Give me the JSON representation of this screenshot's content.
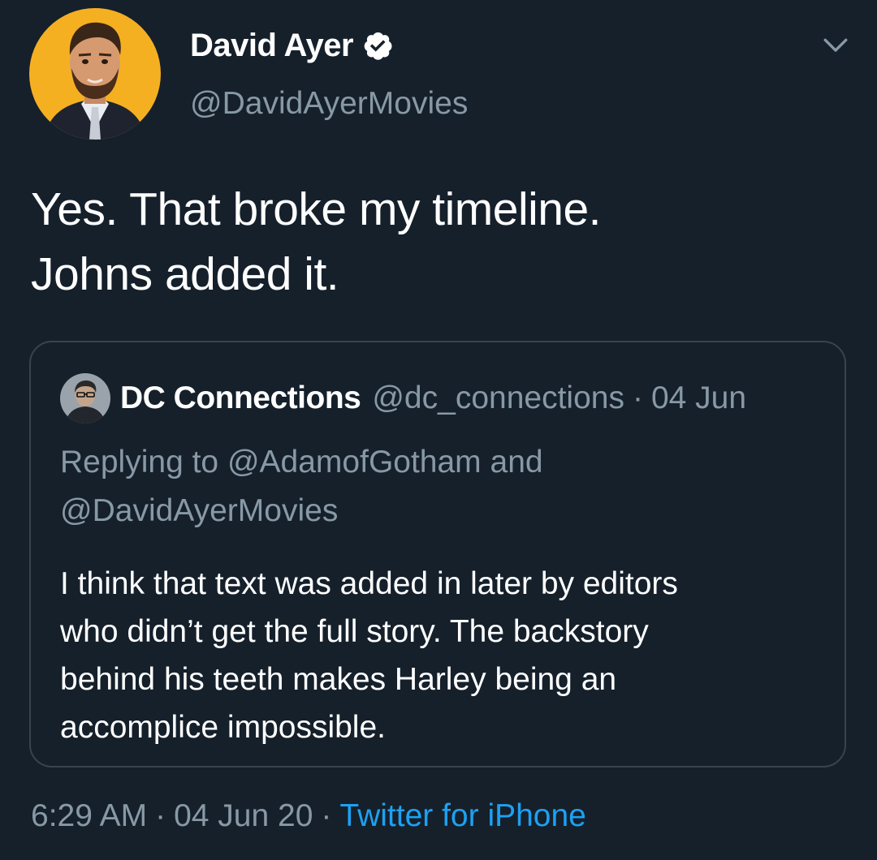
{
  "author": {
    "display_name": "David Ayer",
    "handle": "@DavidAyerMovies",
    "verified": true,
    "avatar_icon": "illustrated-portrait-avatar",
    "avatar_bg": "#f5b021"
  },
  "tweet": {
    "text_lines": [
      "Yes. That broke my timeline.",
      "Johns added it."
    ]
  },
  "quoted_tweet": {
    "display_name": "DC Connections",
    "handle": "@dc_connections",
    "separator": "·",
    "date": "04 Jun",
    "replying_lines": [
      "Replying to @AdamofGotham and",
      "@DavidAyerMovies"
    ],
    "body_lines": [
      "I think that text was added in later by editors",
      "who didn’t get the full story. The backstory",
      "behind his teeth makes Harley being an",
      "accomplice impossible."
    ]
  },
  "meta": {
    "time": "6:29 AM",
    "separator": "·",
    "date": "04 Jun 20",
    "source": "Twitter for iPhone"
  },
  "colors": {
    "background": "#15202b",
    "secondary_text": "#8899a6",
    "link": "#1da1f2",
    "border": "#38444d"
  }
}
